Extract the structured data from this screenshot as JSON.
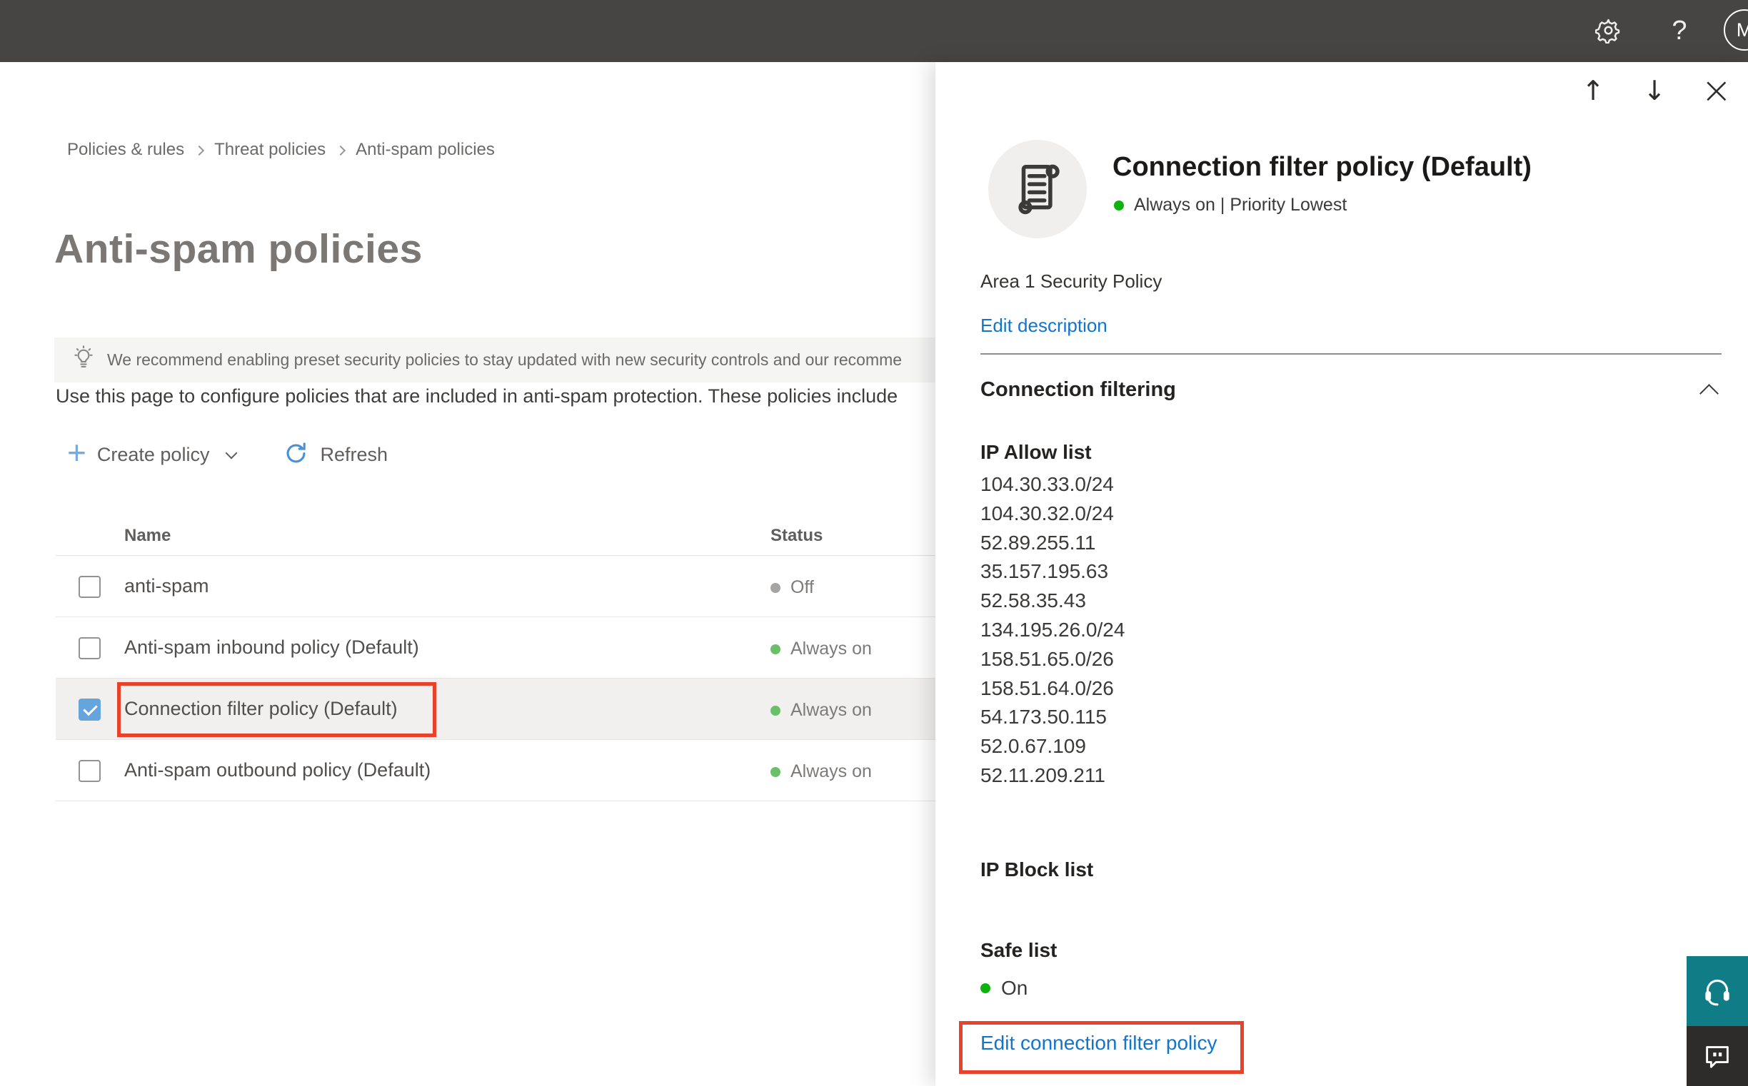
{
  "topbar": {
    "help_label": "?",
    "avatar_initial": "M"
  },
  "breadcrumb": {
    "items": [
      "Policies & rules",
      "Threat policies",
      "Anti-spam policies"
    ]
  },
  "page": {
    "title": "Anti-spam policies",
    "banner_text": "We recommend enabling preset security policies to stay updated with new security controls and our recomme",
    "intro_text": "Use this page to configure policies that are included in anti-spam protection. These policies include",
    "toolbar": {
      "create_policy_label": "Create policy",
      "refresh_label": "Refresh"
    }
  },
  "table": {
    "columns": {
      "name": "Name",
      "status": "Status"
    },
    "rows": [
      {
        "name": "anti-spam",
        "status": "Off"
      },
      {
        "name": "Anti-spam inbound policy (Default)",
        "status": "Always on"
      },
      {
        "name": "Connection filter policy (Default)",
        "status": "Always on"
      },
      {
        "name": "Anti-spam outbound policy (Default)",
        "status": "Always on"
      }
    ]
  },
  "panel": {
    "title": "Connection filter policy (Default)",
    "status_line": "Always on | Priority Lowest",
    "description": "Area 1 Security Policy",
    "edit_description_label": "Edit description",
    "section_title": "Connection filtering",
    "ip_allow_label": "IP Allow list",
    "ip_allow_items": [
      "104.30.33.0/24",
      "104.30.32.0/24",
      "52.89.255.11",
      "35.157.195.63",
      "52.58.35.43",
      "134.195.26.0/24",
      "158.51.65.0/26",
      "158.51.64.0/26",
      "54.173.50.115",
      "52.0.67.109",
      "52.11.209.211"
    ],
    "ip_block_label": "IP Block list",
    "safe_list_label": "Safe list",
    "safe_list_value": "On",
    "edit_link_label": "Edit connection filter policy"
  },
  "colors": {
    "topbar_bg": "#474543",
    "link_blue": "#1374cc",
    "annotation_red": "#e8432a",
    "row_status_green": "#6abf69",
    "panel_status_green": "#0db30d",
    "off_gray": "#a6a4a2",
    "selected_row_bg": "#f1f0ef",
    "checkbox_checked_blue": "#66a4dd",
    "support_teal": "#0f7c86",
    "feedback_dark": "#2e2c2b"
  }
}
